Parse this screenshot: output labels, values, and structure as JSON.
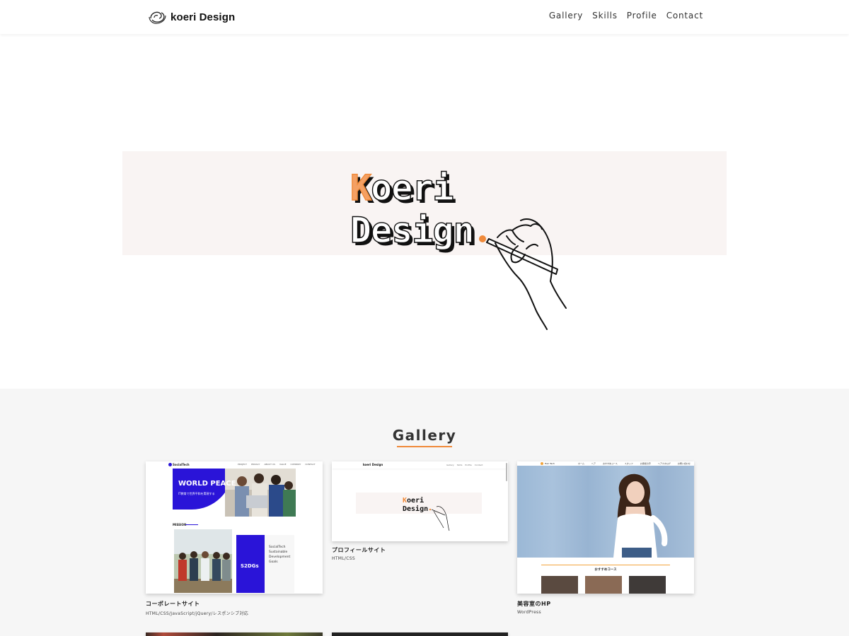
{
  "header": {
    "logo_text": "koeri Design",
    "nav": [
      "Gallery",
      "Skills",
      "Profile",
      "Contact"
    ]
  },
  "hero": {
    "line1": "Koeri",
    "line2": "Design"
  },
  "gallery": {
    "title": "Gallery",
    "items": [
      {
        "title": "コーポレートサイト",
        "tags": "HTML/CSS/JavaScript/jQuery/レスポンシブ対応",
        "thumb": {
          "logo": "SocialTech",
          "nav": [
            "PROJECT",
            "PRIVACY",
            "ABOUT US",
            "VALUE",
            "COMPANY",
            "CONTACT"
          ],
          "hero_text": "WORLD PEACE",
          "hero_sub": "IT教育で世界平和を実現する",
          "section": "MISSION",
          "box_title": "S2DGs",
          "box_text": [
            "SocialTech",
            "Sustainable",
            "Development",
            "Goals"
          ]
        }
      },
      {
        "title": "プロフィールサイト",
        "tags": "HTML/CSS",
        "thumb": {
          "logo": "koeri Design",
          "nav": [
            "Gallery",
            "Skills",
            "Profile",
            "Contact"
          ],
          "line1": "Koeri",
          "line2": "Design"
        }
      },
      {
        "title": "美容室のHP",
        "tags": "WordPress",
        "thumb": {
          "logo": "Hair Tech",
          "nav": [
            "ホーム",
            "ヘア",
            "おすすめコース",
            "スタッフ",
            "お客様の声",
            "ヘアカタログ",
            "お問い合わせ"
          ],
          "section": "おすすめコース"
        }
      }
    ]
  },
  "colors": {
    "accent": "#f08a3a",
    "hero_band": "#f9f4f3",
    "gallery_bg": "#f6f6f6",
    "corporate_blue": "#2a14d8"
  }
}
